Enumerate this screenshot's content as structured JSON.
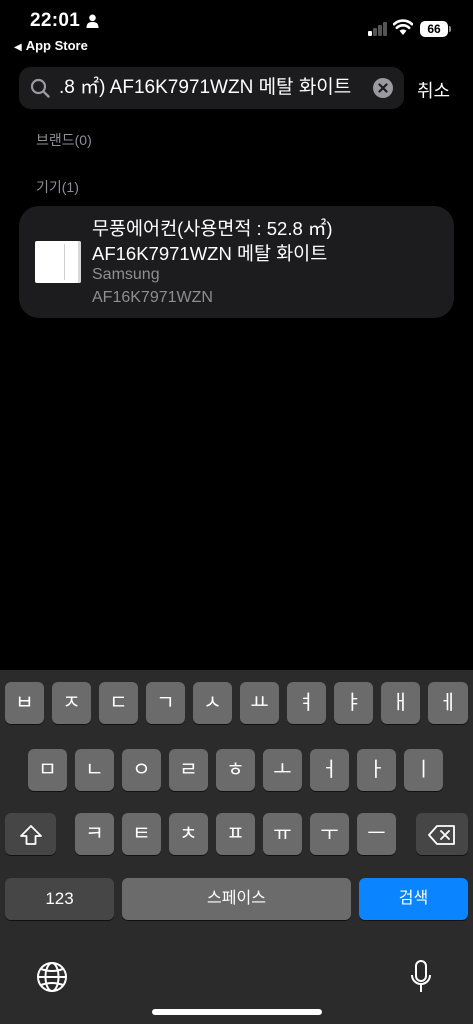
{
  "status_bar": {
    "time": "22:01",
    "back_app": "App Store",
    "battery": "66"
  },
  "search": {
    "value": ".8 ㎡) AF16K7971WZN 메탈 화이트",
    "cancel_label": "취소"
  },
  "sections": {
    "brands_label": "브랜드(0)",
    "devices_label": "기기(1)"
  },
  "result": {
    "title_line1": "무풍에어컨(사용면적 : 52.8 ㎡)",
    "title_line2": "AF16K7971WZN 메탈 화이트",
    "brand": "Samsung",
    "model": "AF16K7971WZN"
  },
  "keyboard": {
    "row1": [
      "ㅂ",
      "ㅈ",
      "ㄷ",
      "ㄱ",
      "ㅅ",
      "ㅛ",
      "ㅕ",
      "ㅑ",
      "ㅐ",
      "ㅔ"
    ],
    "row2": [
      "ㅁ",
      "ㄴ",
      "ㅇ",
      "ㄹ",
      "ㅎ",
      "ㅗ",
      "ㅓ",
      "ㅏ",
      "ㅣ"
    ],
    "row3": [
      "ㅋ",
      "ㅌ",
      "ㅊ",
      "ㅍ",
      "ㅠ",
      "ㅜ",
      "ㅡ"
    ],
    "numbers_label": "123",
    "space_label": "스페이스",
    "search_label": "검색"
  },
  "colors": {
    "accent": "#0a84ff",
    "card": "#1c1c1e",
    "muted": "#8e8e93"
  }
}
